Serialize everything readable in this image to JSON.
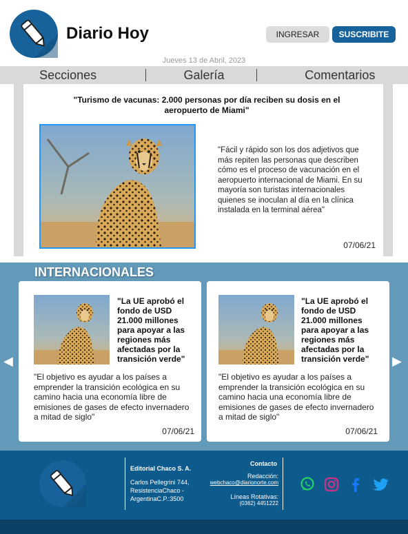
{
  "header": {
    "site_title": "Diario Hoy",
    "login_label": "INGRESAR",
    "subscribe_label": "SUSCRIBITE",
    "date": "Jueves 13 de Abril, 2023"
  },
  "nav": {
    "items": [
      {
        "label": "Secciones"
      },
      {
        "label": "Galería"
      },
      {
        "label": "Comentarios"
      }
    ]
  },
  "featured": {
    "title": "\"Turismo de vacunas: 2.000 personas por día reciben su dosis en el aeropuerto de Miami\"",
    "summary": "\"Fácil y rápido son los dos adjetivos que más repiten las personas que describen cómo es el proceso de vacunación en el aeropuerto internacional de Miami. En su mayoría son turistas internacionales quienes se inoculan al día en la clínica instalada en la terminal aérea\"",
    "date": "07/06/21"
  },
  "international": {
    "section_title": "INTERNACIONALES",
    "prev_arrow": "◀",
    "next_arrow": "▶",
    "cards": [
      {
        "title": "\"La UE aprobó el fondo de USD 21.000 millones para apoyar a las regiones más afectadas por la transición verde\"",
        "summary": "\"El objetivo es ayudar a los países a emprender la transición ecológica en su camino hacia una economía libre de emisiones de gases de efecto invernadero a mitad de siglo\"",
        "date": "07/06/21"
      },
      {
        "title": "\"La UE aprobó el fondo de USD 21.000 millones para apoyar a las regiones más afectadas por la transición verde\"",
        "summary": "\"El objetivo es ayudar a los países a emprender la transición ecológica en su camino hacia una economía libre de emisiones de gases de efecto invernadero a mitad de siglo\"",
        "date": "07/06/21"
      }
    ]
  },
  "footer": {
    "company": "Editorial Chaco S. A.",
    "address": "Carlos Pellegrini 744, ResistenciaChaco - ArgentinaC.P.:3500",
    "contact_title": "Contacto",
    "redaccion_label": "Redacción:",
    "email": "webchaco@diarionorte.com",
    "rotativas_label": "Líneas Rotativas:",
    "phone": "(0362) 4451222",
    "social": [
      {
        "icon": "whatsapp-icon",
        "color": "#25d366"
      },
      {
        "icon": "instagram-icon",
        "color": "#c13584"
      },
      {
        "icon": "facebook-icon",
        "color": "#1877f2"
      },
      {
        "icon": "twitter-icon",
        "color": "#1da1f2"
      }
    ]
  },
  "colors": {
    "brand_blue": "#17629b",
    "section_blue": "#6399b9",
    "footer_blue": "#0d5a8c"
  }
}
